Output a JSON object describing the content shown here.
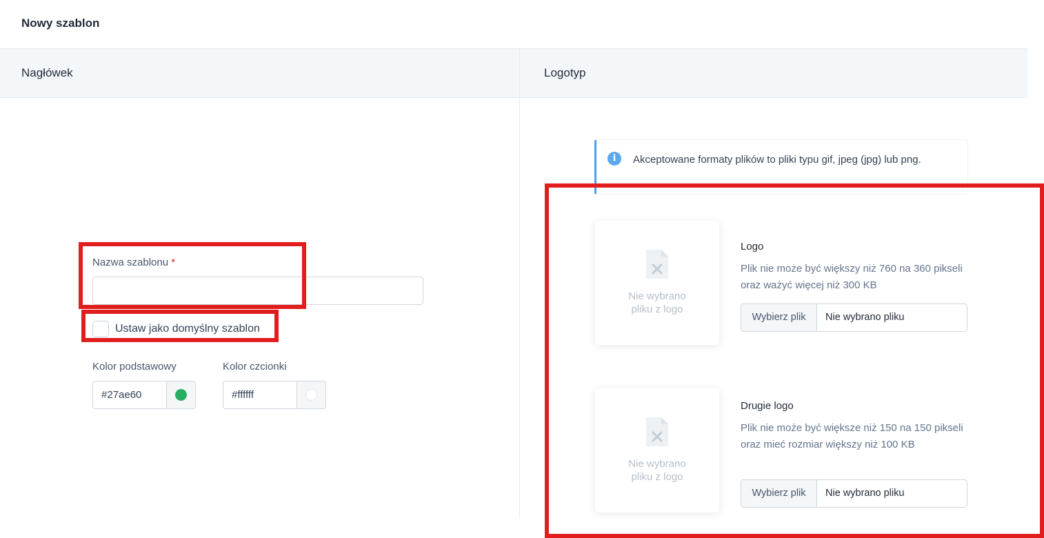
{
  "page": {
    "title": "Nowy szablon"
  },
  "sections": {
    "left_title": "Nagłówek",
    "right_title": "Logotyp"
  },
  "form": {
    "name_label": "Nazwa szablonu",
    "required_mark": "*",
    "name_value": "",
    "default_checkbox_label": "Ustaw jako domyślny szablon",
    "default_checked": false,
    "primary_color_label": "Kolor podstawowy",
    "primary_color_value": "#27ae60",
    "primary_swatch": "#27ae60",
    "font_color_label": "Kolor czcionki",
    "font_color_value": "#ffffff",
    "font_swatch": "#ffffff"
  },
  "info": {
    "icon": "info-icon",
    "text": "Akceptowane formaty plików to pliki typu gif, jpeg (jpg) lub png."
  },
  "logos": [
    {
      "title": "Logo",
      "description": "Plik nie może być większy niż 760 na 360 pikseli oraz ważyć więcej niż 300 KB",
      "placeholder_line1": "Nie wybrano",
      "placeholder_line2": "pliku z logo",
      "button_label": "Wybierz plik",
      "file_status": "Nie wybrano pliku"
    },
    {
      "title": "Drugie logo",
      "description": "Plik nie może być większe niż 150 na 150 pikseli oraz mieć rozmiar większy niż 100 KB",
      "placeholder_line1": "Nie wybrano",
      "placeholder_line2": "pliku z logo",
      "button_label": "Wybierz plik",
      "file_status": "Nie wybrano pliku"
    }
  ],
  "colors": {
    "annotation": "#e11d1d",
    "info_accent": "#4a9eea"
  }
}
